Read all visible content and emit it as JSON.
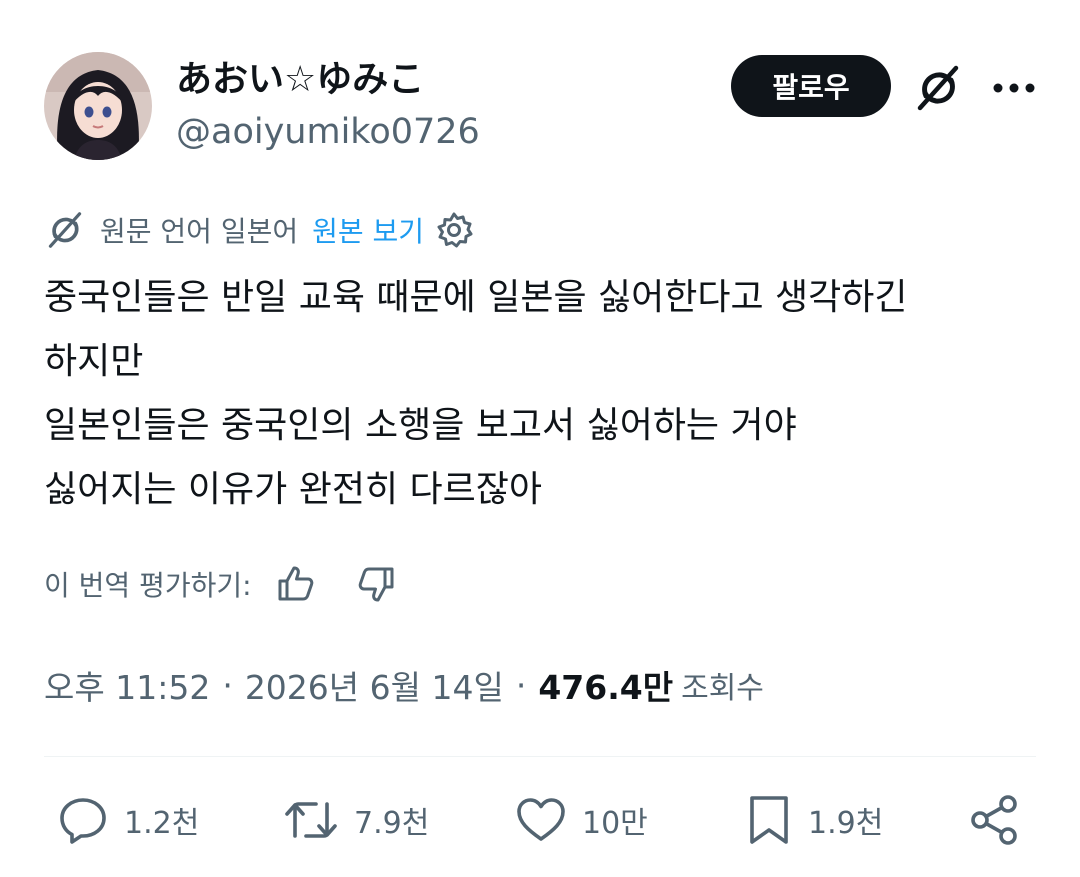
{
  "user": {
    "display_name": "あおい☆ゆみこ",
    "handle": "@aoiyumiko0726"
  },
  "header": {
    "follow_label": "팔로우"
  },
  "translation": {
    "original_language": "원문 언어 일본어",
    "show_original": "원본 보기"
  },
  "tweet": {
    "lines": [
      "중국인들은 반일 교육 때문에 일본을 싫어한다고 생각하긴",
      "하지만",
      "일본인들은 중국인의 소행을 보고서 싫어하는 거야",
      "싫어지는 이유가 완전히 다르잖아"
    ]
  },
  "rating": {
    "label": "이 번역 평가하기:"
  },
  "meta": {
    "time": "오후 11:52",
    "separator": "·",
    "date": "2026년 6월 14일",
    "views_count": "476.4만",
    "views_label": "조회수"
  },
  "actions": {
    "reply_count": "1.2천",
    "retweet_count": "7.9천",
    "like_count": "10만",
    "bookmark_count": "1.9천"
  },
  "icons": {
    "avatar": "avatar",
    "grok": "grok-icon",
    "more": "more-icon",
    "translate": "grok-translate-icon",
    "settings": "gear-icon",
    "thumbs_up": "thumbs-up-icon",
    "thumbs_down": "thumbs-down-icon",
    "reply": "reply-icon",
    "retweet": "retweet-icon",
    "like": "heart-icon",
    "bookmark": "bookmark-icon",
    "share": "share-icon"
  },
  "colors": {
    "text": "#0f1419",
    "secondary": "#536471",
    "link": "#1d9bf0",
    "button_bg": "#0f1419"
  }
}
